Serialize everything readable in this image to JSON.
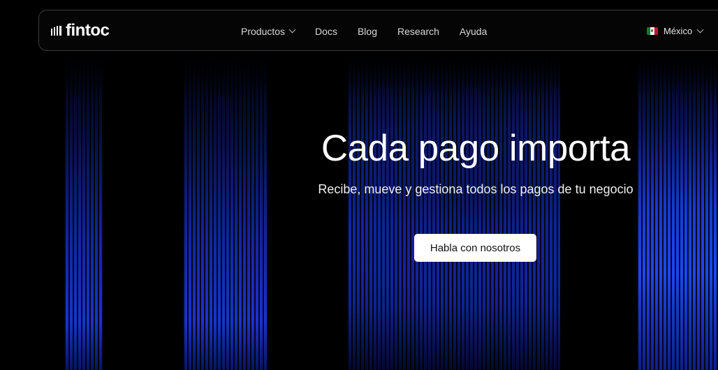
{
  "brand": {
    "name": "fintoc",
    "logo_icon": "bars-logo-icon"
  },
  "nav": {
    "items": [
      {
        "label": "Productos",
        "has_dropdown": true
      },
      {
        "label": "Docs",
        "has_dropdown": false
      },
      {
        "label": "Blog",
        "has_dropdown": false
      },
      {
        "label": "Research",
        "has_dropdown": false
      },
      {
        "label": "Ayuda",
        "has_dropdown": false
      }
    ],
    "country": {
      "label": "México",
      "flag_icon": "mexico-flag-icon",
      "has_dropdown": true
    }
  },
  "hero": {
    "title": "Cada pago importa",
    "subtitle": "Recibe, mueve y gestiona todos los pagos de tu negocio",
    "cta_label": "Habla con nosotros"
  },
  "colors": {
    "background": "#000000",
    "accent_blue": "#1e3fd6",
    "cta_background": "#ffffff",
    "cta_text": "#111111",
    "navbar_border": "#3a3a3a"
  }
}
